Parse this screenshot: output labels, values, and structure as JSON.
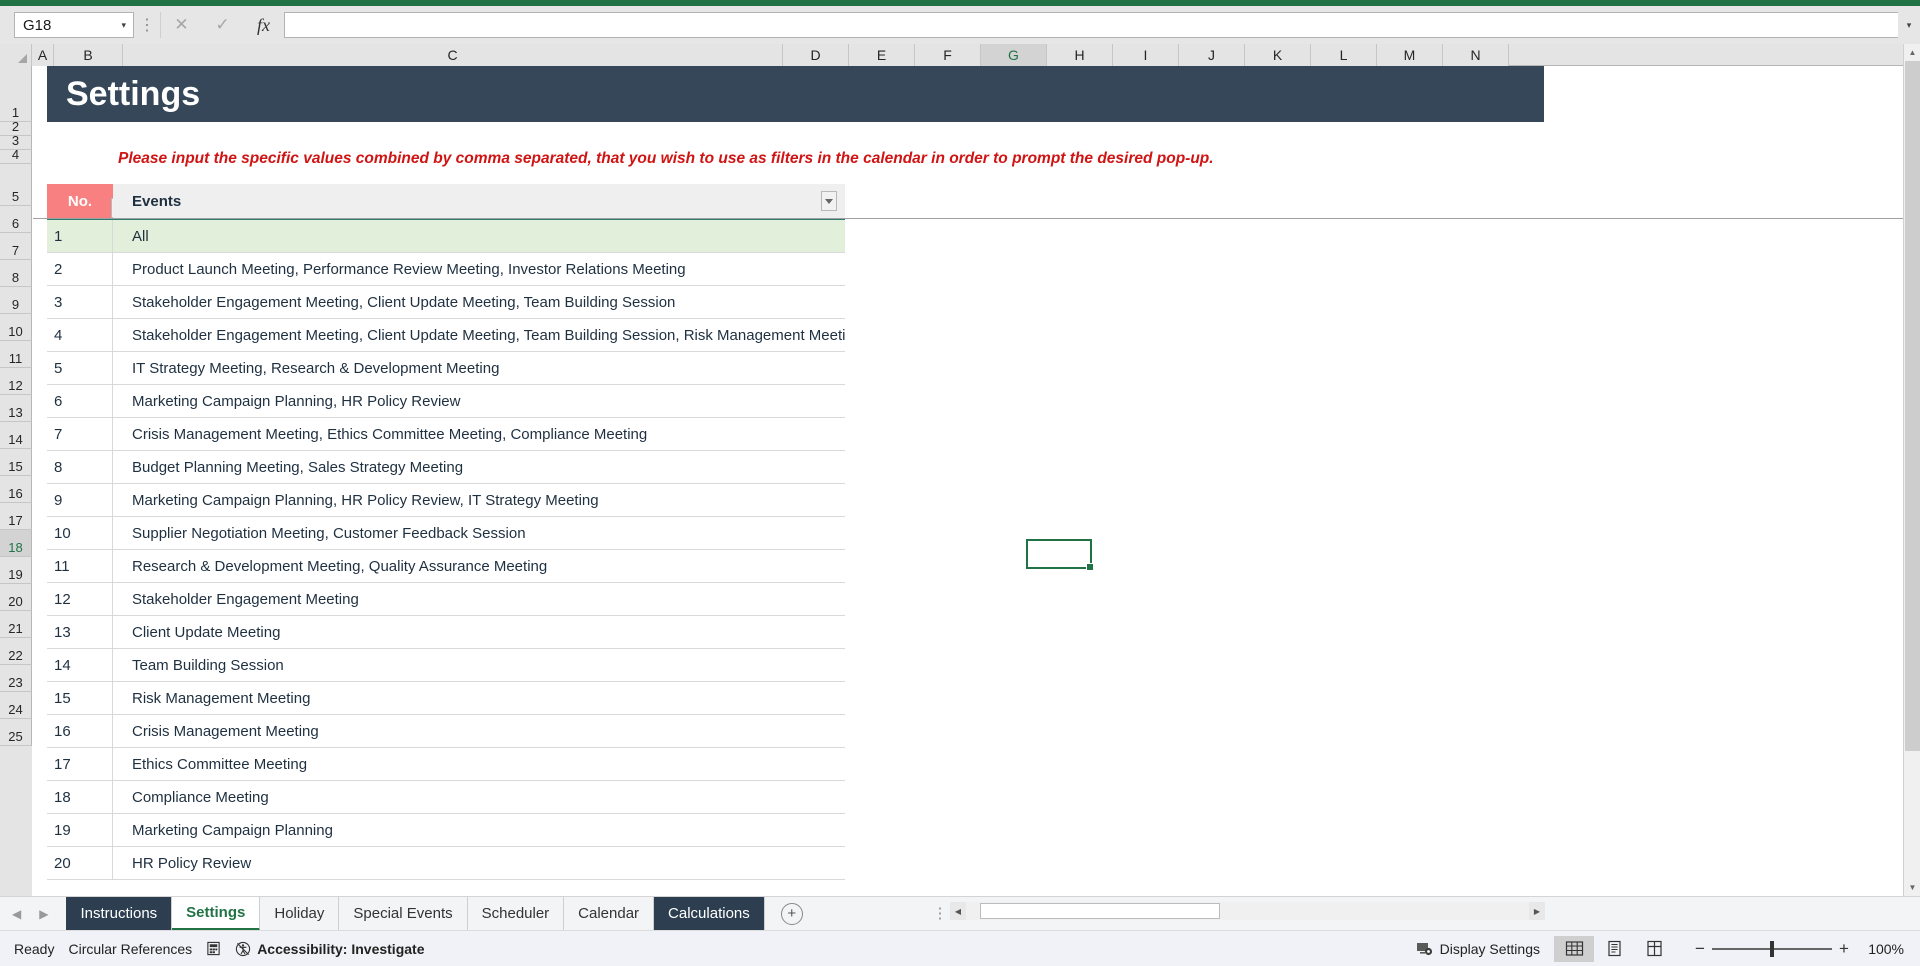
{
  "app": {
    "accent_green": "#217346",
    "banner_color": "#36475a",
    "header_pink": "#f98080",
    "note_red": "#d01414",
    "highlight_green": "#e2efda"
  },
  "formula_bar": {
    "name_box_value": "G18",
    "name_box_arrow": "▾",
    "cancel_icon": "✕",
    "confirm_icon": "✓",
    "fx_icon": "fx",
    "formula_value": "",
    "expand_icon": "▾",
    "more_icon": "⋮"
  },
  "grid": {
    "columns": [
      "A",
      "B",
      "C",
      "D",
      "E",
      "F",
      "G",
      "H",
      "I",
      "J",
      "K",
      "L",
      "M",
      "N"
    ],
    "selected_column": "G",
    "rows": [
      "1",
      "2",
      "3",
      "4",
      "5",
      "6",
      "7",
      "8",
      "9",
      "10",
      "11",
      "12",
      "13",
      "14",
      "15",
      "16",
      "17",
      "18",
      "19",
      "20",
      "21",
      "22",
      "23",
      "24",
      "25"
    ],
    "selected_row": "18",
    "selected_cell": "G18"
  },
  "sheet": {
    "title": "Settings",
    "note": "Please input the specific values combined by comma separated, that you wish to use as filters in the calendar in order to prompt the desired pop-up.",
    "table": {
      "headers": [
        "No.",
        "Events"
      ],
      "filter_icon": "▾",
      "rows": [
        {
          "no": "1",
          "events": "All",
          "highlight": true
        },
        {
          "no": "2",
          "events": "Product Launch Meeting, Performance Review Meeting, Investor Relations Meeting",
          "highlight": false
        },
        {
          "no": "3",
          "events": "Stakeholder Engagement Meeting, Client Update Meeting, Team Building Session",
          "highlight": false
        },
        {
          "no": "4",
          "events": "Stakeholder Engagement Meeting, Client Update Meeting, Team Building Session, Risk Management Meeting",
          "highlight": false
        },
        {
          "no": "5",
          "events": "IT Strategy Meeting, Research & Development Meeting",
          "highlight": false
        },
        {
          "no": "6",
          "events": "Marketing Campaign Planning, HR Policy Review",
          "highlight": false
        },
        {
          "no": "7",
          "events": "Crisis Management Meeting, Ethics Committee Meeting, Compliance Meeting",
          "highlight": false
        },
        {
          "no": "8",
          "events": "Budget Planning Meeting, Sales Strategy Meeting",
          "highlight": false
        },
        {
          "no": "9",
          "events": "Marketing Campaign Planning, HR Policy Review, IT Strategy Meeting",
          "highlight": false
        },
        {
          "no": "10",
          "events": "Supplier Negotiation Meeting, Customer Feedback Session",
          "highlight": false
        },
        {
          "no": "11",
          "events": "Research & Development Meeting, Quality Assurance Meeting",
          "highlight": false
        },
        {
          "no": "12",
          "events": "Stakeholder Engagement Meeting",
          "highlight": false
        },
        {
          "no": "13",
          "events": "Client Update Meeting",
          "highlight": false
        },
        {
          "no": "14",
          "events": "Team Building Session",
          "highlight": false
        },
        {
          "no": "15",
          "events": "Risk Management Meeting",
          "highlight": false
        },
        {
          "no": "16",
          "events": "Crisis Management Meeting",
          "highlight": false
        },
        {
          "no": "17",
          "events": "Ethics Committee Meeting",
          "highlight": false
        },
        {
          "no": "18",
          "events": "Compliance Meeting",
          "highlight": false
        },
        {
          "no": "19",
          "events": "Marketing Campaign Planning",
          "highlight": false
        },
        {
          "no": "20",
          "events": "HR Policy Review",
          "highlight": false
        }
      ]
    }
  },
  "sheet_tabs": {
    "prev_icon": "◀",
    "next_icon": "▶",
    "add_icon": "+",
    "overflow_icon": "⋮",
    "items": [
      {
        "label": "Instructions",
        "style": "dark"
      },
      {
        "label": "Settings",
        "style": "active"
      },
      {
        "label": "Holiday",
        "style": "normal"
      },
      {
        "label": "Special Events",
        "style": "normal"
      },
      {
        "label": "Scheduler",
        "style": "normal"
      },
      {
        "label": "Calendar",
        "style": "normal"
      },
      {
        "label": "Calculations",
        "style": "dark"
      }
    ]
  },
  "status_bar": {
    "ready": "Ready",
    "circular_references": "Circular References",
    "accessibility": "Accessibility: Investigate",
    "display_settings": "Display Settings",
    "zoom_label": "100%",
    "zoom_minus": "−",
    "zoom_plus": "+",
    "views": [
      "normal-view",
      "page-layout-view",
      "page-break-view"
    ]
  }
}
